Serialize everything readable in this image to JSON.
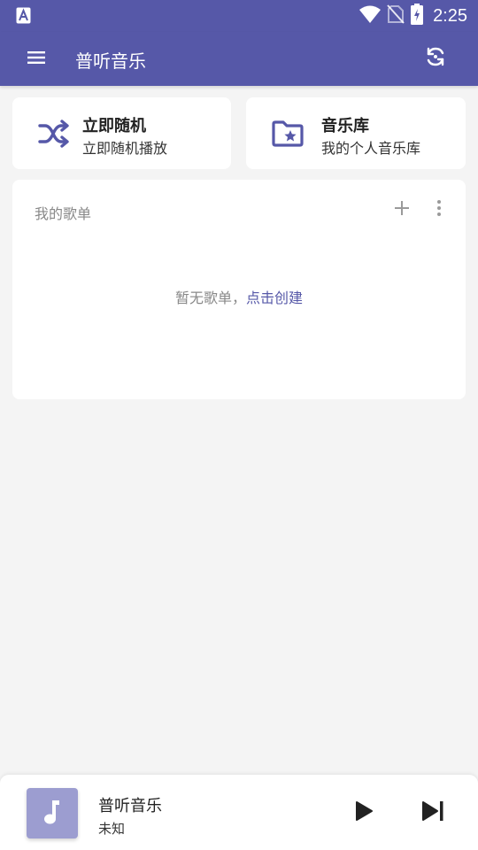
{
  "status_bar": {
    "time": "2:25",
    "icons": [
      "accessibility-a-icon",
      "wifi-icon",
      "no-sim-icon",
      "battery-charging-icon"
    ]
  },
  "app_bar": {
    "title": "普听音乐",
    "icons": [
      "menu-icon",
      "sync-icon"
    ]
  },
  "quick_actions": {
    "shuffle": {
      "title": "立即随机",
      "subtitle": "立即随机播放",
      "icon": "shuffle-icon"
    },
    "library": {
      "title": "音乐库",
      "subtitle": "我的个人音乐库",
      "icon": "folder-star-icon"
    }
  },
  "playlists": {
    "header": "我的歌单",
    "empty_text": "暂无歌单，",
    "create_link": "点击创建",
    "icons": [
      "add-icon",
      "more-vert-icon"
    ]
  },
  "mini_player": {
    "title": "普听音乐",
    "artist": "未知",
    "icons": [
      "music-note-icon",
      "play-icon",
      "skip-next-icon"
    ]
  },
  "colors": {
    "primary": "#5658a8",
    "background": "#f4f4f4",
    "card": "#ffffff",
    "cover": "#9c9dd0",
    "muted_text": "#888888"
  }
}
